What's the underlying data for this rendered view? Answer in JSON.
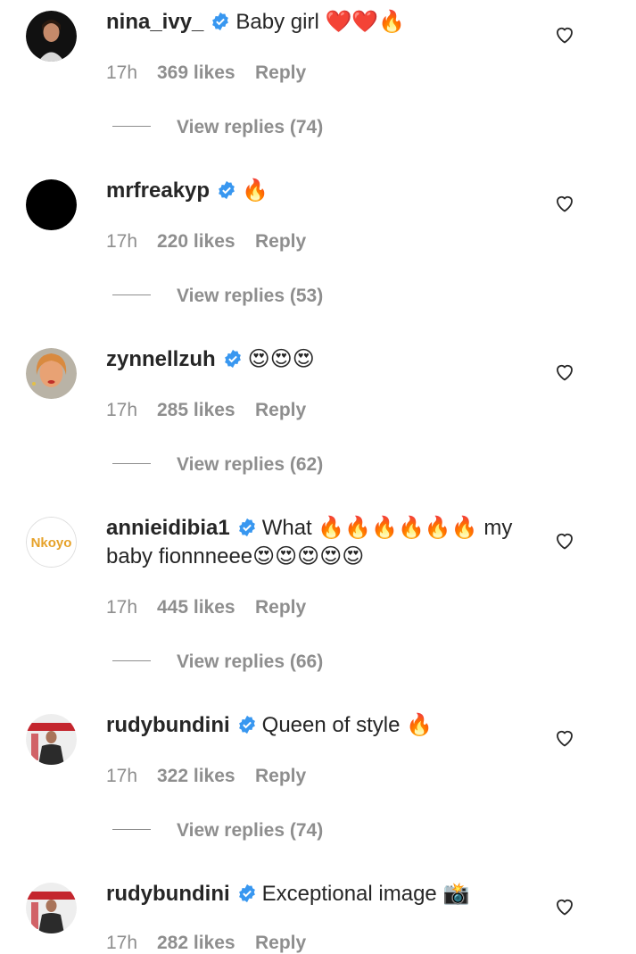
{
  "comments": [
    {
      "username": "nina_ivy_",
      "text": "Baby girl ❤️❤️🔥",
      "time": "17h",
      "likes": "369 likes",
      "reply_label": "Reply",
      "replies": "View replies (74)",
      "avatar": "woman-portrait-dark"
    },
    {
      "username": "mrfreakyp",
      "text": "🔥",
      "time": "17h",
      "likes": "220 likes",
      "reply_label": "Reply",
      "replies": "View replies (53)",
      "avatar": "black-circle"
    },
    {
      "username": "zynnellzuh",
      "text": "😍😍😍",
      "time": "17h",
      "likes": "285 likes",
      "reply_label": "Reply",
      "replies": "View replies (62)",
      "avatar": "woman-portrait-red"
    },
    {
      "username": "annieidibia1",
      "text": "What 🔥🔥🔥🔥🔥🔥 my baby fionnneee😍😍😍😍😍",
      "time": "17h",
      "likes": "445 likes",
      "reply_label": "Reply",
      "replies": "View replies (66)",
      "avatar": "nkoyo-logo"
    },
    {
      "username": "rudybundini",
      "text": "Queen of style 🔥",
      "time": "17h",
      "likes": "322 likes",
      "reply_label": "Reply",
      "replies": "View replies (74)",
      "avatar": "magazine-cover"
    },
    {
      "username": "rudybundini",
      "text": "Exceptional image 📸",
      "time": "17h",
      "likes": "282 likes",
      "reply_label": "Reply",
      "replies": "",
      "avatar": "magazine-cover"
    }
  ],
  "logo_text": "Nkoyo",
  "colors": {
    "verified": "#3897f0",
    "muted": "#8e8e8e",
    "text": "#262626"
  }
}
